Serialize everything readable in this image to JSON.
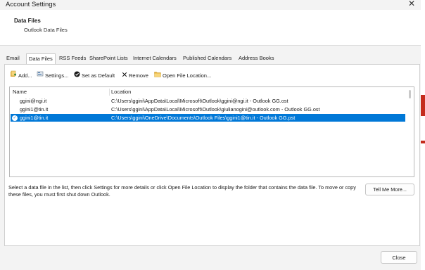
{
  "window": {
    "title": "Account Settings"
  },
  "header": {
    "title": "Data Files",
    "subtitle": "Outlook Data Files"
  },
  "tabs": [
    {
      "label": "Email"
    },
    {
      "label": "Data Files",
      "active": true
    },
    {
      "label": "RSS Feeds"
    },
    {
      "label": "SharePoint Lists"
    },
    {
      "label": "Internet Calendars"
    },
    {
      "label": "Published Calendars"
    },
    {
      "label": "Address Books"
    }
  ],
  "toolbar": {
    "add_label": "Add...",
    "settings_label": "Settings...",
    "set_default_label": "Set as Default",
    "remove_label": "Remove",
    "open_location_label": "Open File Location..."
  },
  "list": {
    "columns": {
      "name": "Name",
      "location": "Location"
    },
    "rows": [
      {
        "name": "ggini@ngi.it",
        "location": "C:\\Users\\ggini\\AppData\\Local\\Microsoft\\Outlook\\ggini@ngi.it - Outlook GG.ost",
        "selected": false
      },
      {
        "name": "ggini1@tin.it",
        "location": "C:\\Users\\ggini\\AppData\\Local\\Microsoft\\Outlook\\giulianogini@outlook.com - Outlook GG.ost",
        "selected": false
      },
      {
        "name": "ggini1@tin.it",
        "location": "C:\\Users\\ggini\\OneDrive\\Documents\\Outlook Files\\ggini1@tin.it - Outlook GG.pst",
        "selected": true
      }
    ]
  },
  "help_text": "Select a data file in the list, then click Settings for more details or click Open File Location to display the folder that contains the data file. To move or copy these files, you must first shut down Outlook.",
  "tell_me_more_label": "Tell Me More...",
  "close_label": "Close",
  "colors": {
    "selection": "#0078d7",
    "accent_red": "#c42b1c"
  }
}
